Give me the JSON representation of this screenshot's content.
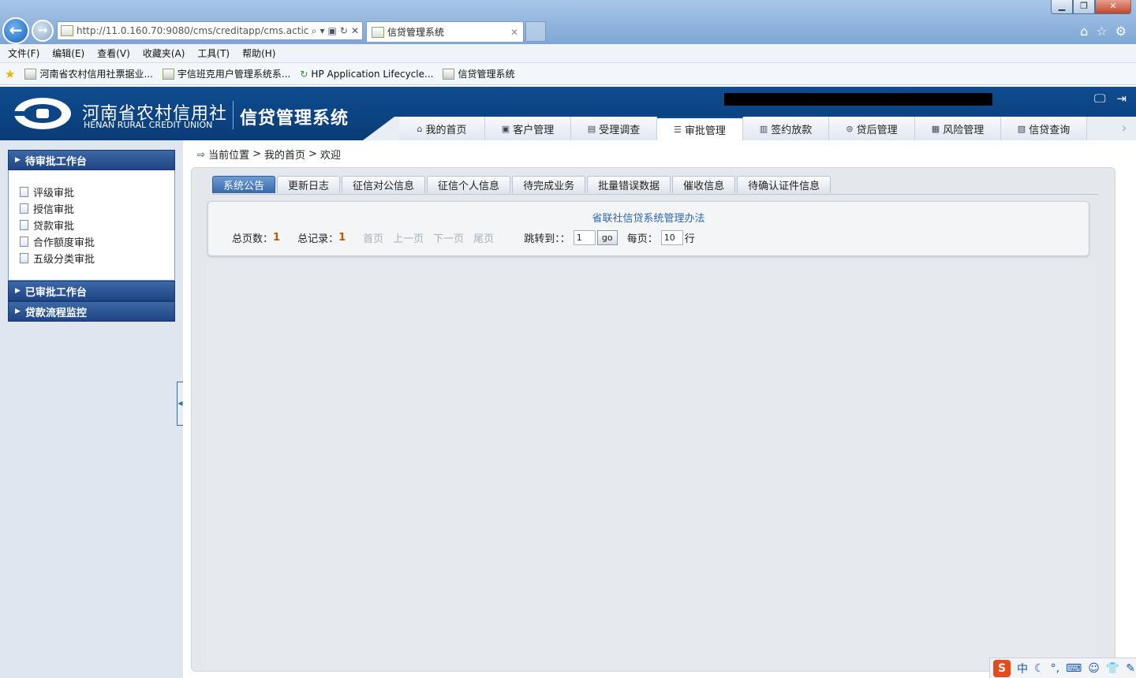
{
  "browser": {
    "url": "http://11.0.160.70:9080/cms/creditapp/cms.actic",
    "tab_title": "信贷管理系统",
    "menu": [
      "文件(F)",
      "编辑(E)",
      "查看(V)",
      "收藏夹(A)",
      "工具(T)",
      "帮助(H)"
    ],
    "favorites": [
      "河南省农村信用社票据业...",
      "宇信班克用户管理系统系...",
      "HP Application Lifecycle...",
      "信贷管理系统"
    ]
  },
  "header": {
    "org_cn": "河南省农村信用社",
    "org_en": "HENAN RURAL CREDIT UNION",
    "system_name": "信贷管理系统",
    "nav": [
      "我的首页",
      "客户管理",
      "受理调查",
      "审批管理",
      "签约放款",
      "贷后管理",
      "风险管理",
      "信贷查询"
    ]
  },
  "sidebar": {
    "pending": {
      "title": "待审批工作台",
      "items": [
        "评级审批",
        "授信审批",
        "贷款审批",
        "合作额度审批",
        "五级分类审批"
      ]
    },
    "approved_title": "已审批工作台",
    "monitor_title": "贷款流程监控"
  },
  "breadcrumb": {
    "label": "当前位置",
    "sep": ">",
    "home": "我的首页",
    "current": "欢迎"
  },
  "subtabs": [
    "系统公告",
    "更新日志",
    "征信对公信息",
    "征信个人信息",
    "待完成业务",
    "批量错误数据",
    "催收信息",
    "待确认证件信息"
  ],
  "notice": {
    "title": "省联社信贷系统管理办法",
    "total_pages_label": "总页数：",
    "total_pages": "1",
    "total_records_label": "总记录：",
    "total_records": "1",
    "first": "首页",
    "prev": "上一页",
    "next": "下一页",
    "last": "尾页",
    "jump_label": "跳转到：：",
    "jump_value": "1",
    "go": "go",
    "per_page_label": "每页：",
    "per_page": "10",
    "rows_suffix": "行"
  },
  "tray": {
    "ime_mode": "中"
  }
}
